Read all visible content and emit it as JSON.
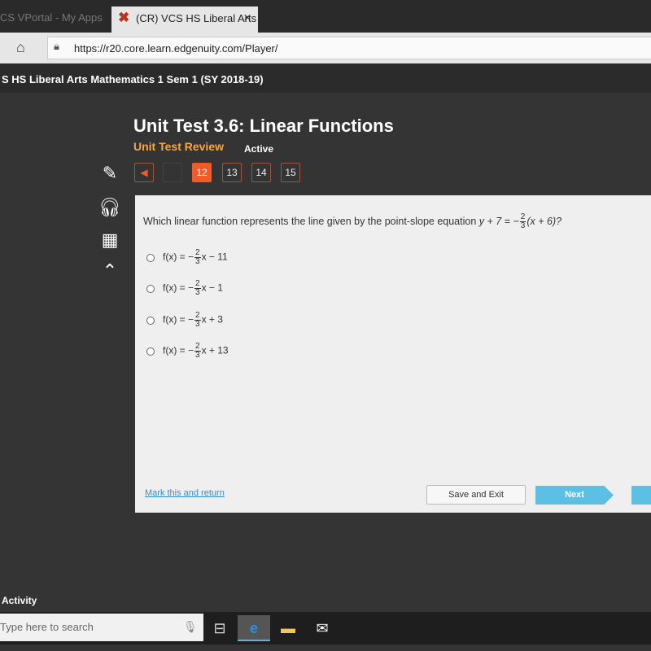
{
  "browser": {
    "tabs": [
      {
        "label": "CS VPortal - My Apps",
        "active": false
      },
      {
        "label": "(CR) VCS HS Liberal Arts",
        "active": true
      }
    ],
    "url": "https://r20.core.learn.edgenuity.com/Player/"
  },
  "course": {
    "title": "S HS Liberal Arts Mathematics 1 Sem 1 (SY 2018-19)"
  },
  "header": {
    "title": "Unit Test 3.6: Linear Functions",
    "subtitle": "Unit Test Review",
    "status": "Active"
  },
  "nav": {
    "pages": [
      "12",
      "13",
      "14",
      "15"
    ],
    "current": "12"
  },
  "question": {
    "text": "Which linear function represents the line given by the point-slope equation ",
    "equation": {
      "lhs": "y + 7 = −",
      "num": "2",
      "den": "3",
      "rhs": "(x + 6)?"
    },
    "options": [
      {
        "prefix": "f(x) = −",
        "num": "2",
        "den": "3",
        "suffix": "x − 11"
      },
      {
        "prefix": "f(x) = −",
        "num": "2",
        "den": "3",
        "suffix": "x − 1"
      },
      {
        "prefix": "f(x) = −",
        "num": "2",
        "den": "3",
        "suffix": "x + 3"
      },
      {
        "prefix": "f(x) = −",
        "num": "2",
        "den": "3",
        "suffix": "x + 13"
      }
    ]
  },
  "footer": {
    "mark": "Mark this and return",
    "save": "Save and Exit",
    "next": "Next"
  },
  "activity": "Activity",
  "taskbar": {
    "search_placeholder": "Type here to search"
  },
  "colors": {
    "accent": "#f25a2a",
    "subtitle": "#f4a742",
    "next": "#5bc0e4"
  }
}
